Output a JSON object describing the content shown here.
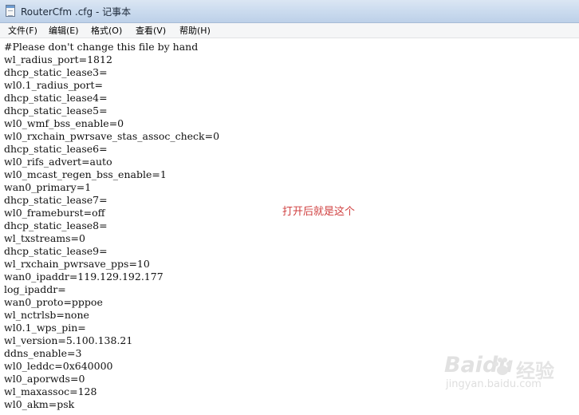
{
  "window": {
    "title": "RouterCfm .cfg - 记事本"
  },
  "menu": [
    "文件(F)",
    "编辑(E)",
    "格式(O)",
    "查看(V)",
    "帮助(H)"
  ],
  "lines": [
    "#Please don't change this file by hand",
    "wl_radius_port=1812",
    "dhcp_static_lease3=",
    "wl0.1_radius_port=",
    "dhcp_static_lease4=",
    "dhcp_static_lease5=",
    "wl0_wmf_bss_enable=0",
    "wl0_rxchain_pwrsave_stas_assoc_check=0",
    "dhcp_static_lease6=",
    "wl0_rifs_advert=auto",
    "wl0_mcast_regen_bss_enable=1",
    "wan0_primary=1",
    "dhcp_static_lease7=",
    "wl0_frameburst=off",
    "dhcp_static_lease8=",
    "wl_txstreams=0",
    "dhcp_static_lease9=",
    "wl_rxchain_pwrsave_pps=10",
    "wan0_ipaddr=119.129.192.177",
    "log_ipaddr=",
    "wan0_proto=pppoe",
    "wl_nctrlsb=none",
    "wl0.1_wps_pin=",
    "wl_version=5.100.138.21",
    "ddns_enable=3",
    "wl0_leddc=0x640000",
    "wl0_aporwds=0",
    "wl_maxassoc=128",
    "wl0_akm=psk"
  ],
  "annotation": "打开后就是这个",
  "watermark": {
    "brand": "Baidu",
    "brand_cn": "经验",
    "site": "jingyan.baidu.com"
  }
}
